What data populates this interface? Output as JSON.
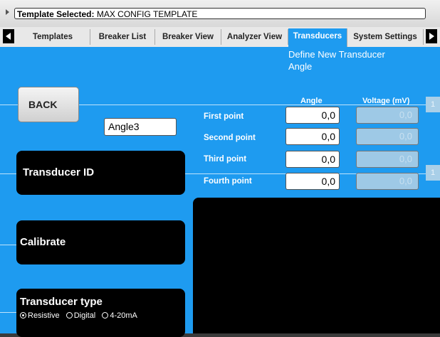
{
  "header": {
    "template_label": "Template Selected:",
    "template_name": "MAX CONFIG TEMPLATE"
  },
  "tabs": [
    {
      "label": "Templates"
    },
    {
      "label": "Breaker List"
    },
    {
      "label": "Breaker View"
    },
    {
      "label": "Analyzer View"
    },
    {
      "label": "Transducers",
      "active": true
    },
    {
      "label": "System Settings"
    }
  ],
  "page": {
    "title_line1": "Define New Transducer",
    "title_line2": "Angle"
  },
  "back_label": "BACK",
  "table": {
    "angle_header": "Angle",
    "voltage_header": "Voltage (mV)",
    "rows": [
      {
        "label": "First point",
        "angle": "0,0",
        "voltage": "0,0"
      },
      {
        "label": "Second point",
        "angle": "0,0",
        "voltage": "0,0"
      },
      {
        "label": "Third point",
        "angle": "0,0",
        "voltage": "0,0"
      },
      {
        "label": "Fourth point",
        "angle": "0,0",
        "voltage": "0,0"
      }
    ],
    "side_markers": [
      "1",
      "1"
    ]
  },
  "transducer_id": {
    "label": "Transducer ID",
    "value": "Angle3"
  },
  "calibrate_label": "Calibrate",
  "transducer_type": {
    "label": "Transducer type",
    "options": [
      {
        "label": "Resistive",
        "selected": true
      },
      {
        "label": "Digital",
        "selected": false
      },
      {
        "label": "4-20mA",
        "selected": false
      }
    ]
  },
  "colors": {
    "accent": "#1e9bf0",
    "panel": "#000000"
  }
}
